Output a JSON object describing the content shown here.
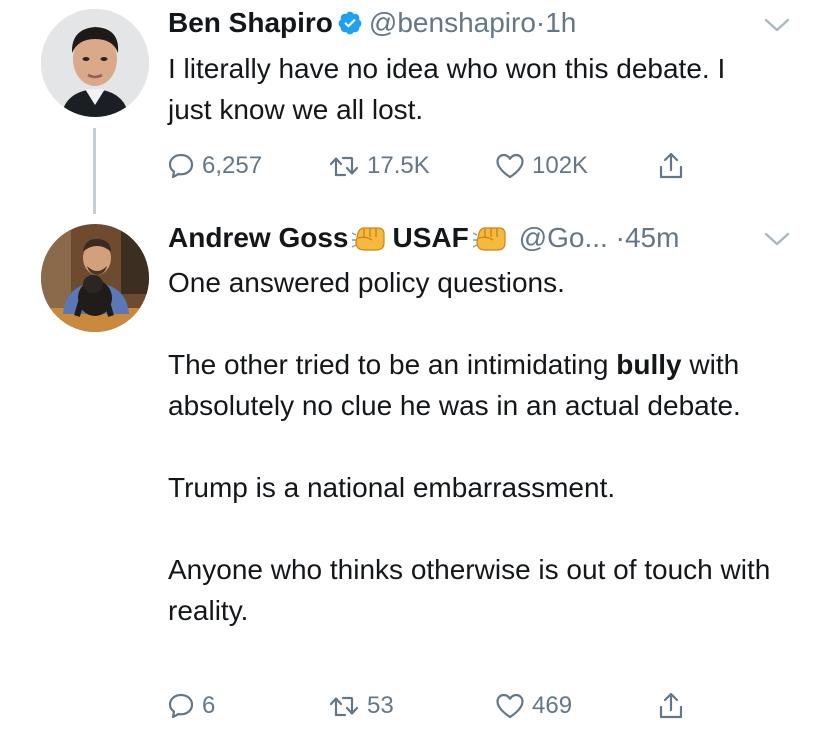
{
  "tweets": [
    {
      "author_name": "Ben Shapiro",
      "verified": true,
      "handle": "@benshapiro",
      "separator": "·",
      "time": "1h",
      "paragraphs": [
        {
          "text": "I literally have no idea who won this debate. I just know we all lost."
        }
      ],
      "actions": {
        "replies": "6,257",
        "retweets": "17.5K",
        "likes": "102K"
      }
    },
    {
      "author_name_part1": "Andrew Goss",
      "author_name_part2": "USAF",
      "name_emoji": "fist-bump-emoji",
      "handle": "@Go...",
      "separator": "·",
      "time": "45m",
      "paragraphs": [
        {
          "text": "One answered policy questions."
        },
        {
          "pre": "The other tried to be an intimidating ",
          "bold": "bully",
          "post": " with absolutely no clue he was in an actual debate."
        },
        {
          "text": "Trump is a national embarrassment."
        },
        {
          "text": "Anyone who thinks otherwise is out of touch with reality."
        }
      ],
      "actions": {
        "replies": "6",
        "retweets": "53",
        "likes": "469"
      }
    }
  ],
  "colors": {
    "text": "#14171a",
    "secondary": "#657786",
    "verified_blue": "#1da1f2",
    "thread_line": "#c4cfd6"
  }
}
